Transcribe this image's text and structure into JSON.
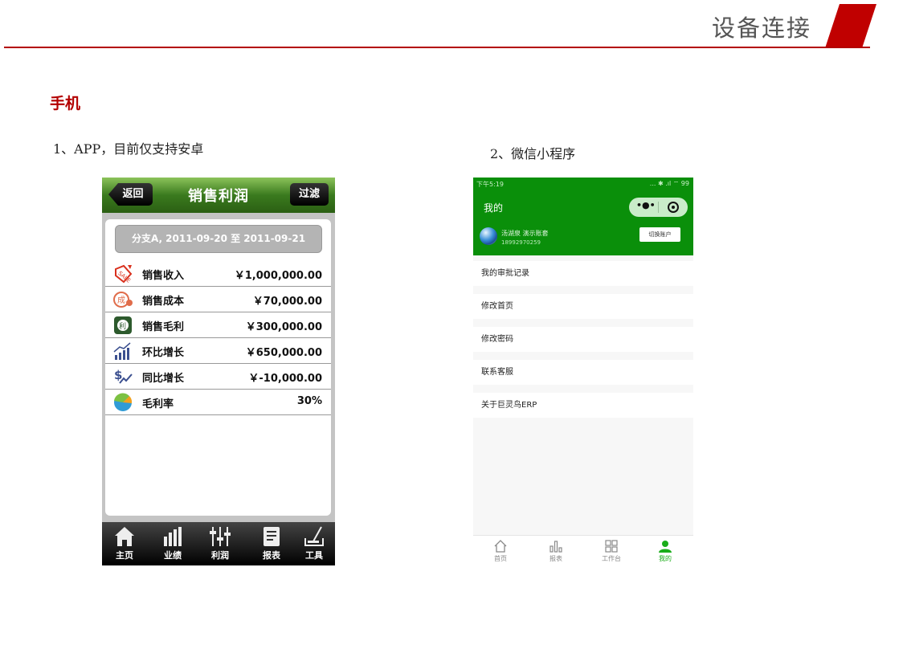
{
  "slide": {
    "title": "设备连接",
    "section": "手机",
    "caption_app": "1、APP，目前仅支持安卓",
    "caption_mini": "2、微信小程序",
    "accent_color": "#b30000"
  },
  "app": {
    "header": {
      "back": "返回",
      "title": "销售利润",
      "filter": "过滤"
    },
    "date_range": "分支A, 2011-09-20 至 2011-09-21",
    "rows": [
      {
        "icon": "sale-tag-icon",
        "label": "销售收入",
        "value": "￥1,000,000.00"
      },
      {
        "icon": "cost-icon",
        "label": "销售成本",
        "value": "￥70,000.00"
      },
      {
        "icon": "profit-icon",
        "label": "销售毛利",
        "value": "￥300,000.00"
      },
      {
        "icon": "growth-chart-icon",
        "label": "环比增长",
        "value": "￥650,000.00"
      },
      {
        "icon": "dollar-trend-icon",
        "label": "同比增长",
        "value": "￥-10,000.00"
      },
      {
        "icon": "pie-icon",
        "label": "毛利率",
        "value": "30%"
      }
    ],
    "tabs": [
      {
        "icon": "home-icon",
        "label": "主页"
      },
      {
        "icon": "bar-chart-icon",
        "label": "业绩"
      },
      {
        "icon": "sliders-icon",
        "label": "利润"
      },
      {
        "icon": "report-icon",
        "label": "报表"
      },
      {
        "icon": "tools-icon",
        "label": "工具"
      }
    ],
    "header_color": "#3a7a1e"
  },
  "mini": {
    "status_time": "下午5:19",
    "status_icons": "... ✱ .ıl ⌔ 99",
    "title": "我的",
    "capsule_dots": "•●•",
    "user_name": "汤湖泉    演示账套",
    "user_phone": "18992970259",
    "switch_button": "切换账户",
    "menu": [
      "我的审批记录",
      "修改首页",
      "修改密码",
      "联系客服",
      "关于巨灵鸟ERP"
    ],
    "tabs": [
      {
        "icon": "home-outline-icon",
        "label": "首页"
      },
      {
        "icon": "report-bars-icon",
        "label": "报表"
      },
      {
        "icon": "grid-icon",
        "label": "工作台"
      },
      {
        "icon": "user-icon",
        "label": "我的",
        "active": true
      }
    ],
    "header_color": "#0a8f0a",
    "active_tab_color": "#1aad19"
  }
}
